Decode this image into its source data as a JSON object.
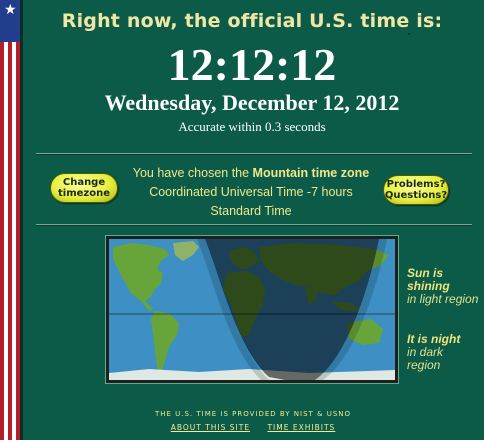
{
  "header": {
    "headline": "Right now, the official U.S. time is:",
    "time": "12:12:12",
    "date": "Wednesday, December 12, 2012",
    "accuracy": "Accurate within 0.3 seconds"
  },
  "zone": {
    "prefix": "You have chosen the ",
    "name": "Mountain time zone",
    "utc_offset": "Coordinated Universal Time -7 hours",
    "mode": "Standard Time"
  },
  "buttons": {
    "change_timezone_line1": "Change",
    "change_timezone_line2": "timezone",
    "problems_line1": "Problems?",
    "problems_line2": "Questions?"
  },
  "legend": {
    "light_title": "Sun is shining",
    "light_desc": "in light region",
    "dark_title": "It is night",
    "dark_desc": "in dark region"
  },
  "footer": {
    "credit": "THE U.S. TIME IS PROVIDED BY NIST & USNO",
    "about_link": "ABOUT THIS SITE",
    "exhibits_link": "TIME EXHIBITS"
  },
  "colors": {
    "background": "#0b5b48",
    "headline": "#f1e7a4",
    "button": "#e7ef41",
    "ocean": "#3d8fc4",
    "land": "#67a53a",
    "night_shade": "#000000"
  },
  "icons": {
    "flag": "us-flag-stripe-icon",
    "star": "star-icon"
  }
}
